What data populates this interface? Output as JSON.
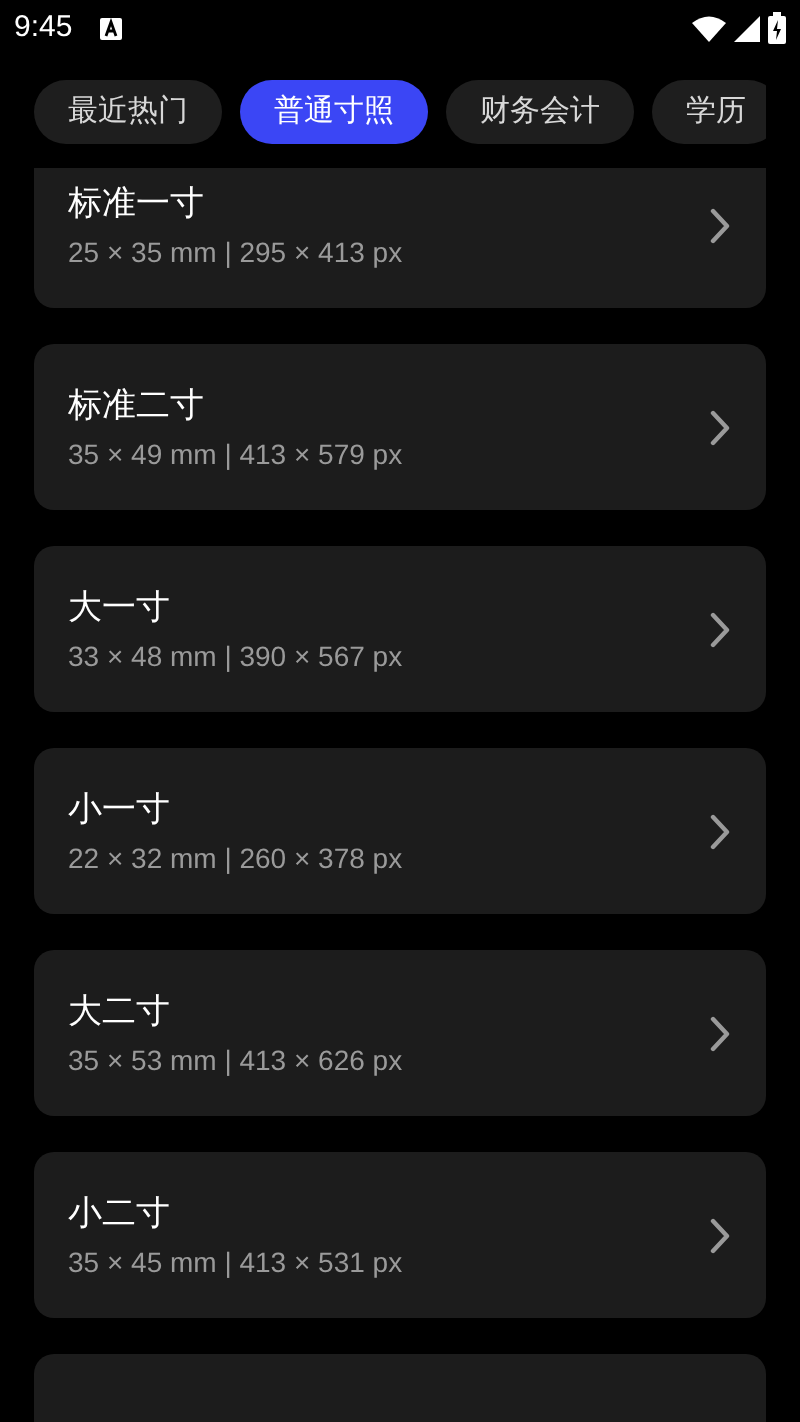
{
  "status_bar": {
    "time": "9:45"
  },
  "tabs": [
    {
      "label": "最近热门",
      "selected": false
    },
    {
      "label": "普通寸照",
      "selected": true
    },
    {
      "label": "财务会计",
      "selected": false
    },
    {
      "label": "学历",
      "selected": false
    }
  ],
  "items": [
    {
      "kind": "size",
      "title": "标准一寸",
      "spec": "25 × 35 mm | 295 × 413 px"
    },
    {
      "kind": "size",
      "title": "标准二寸",
      "spec": "35 × 49 mm | 413 × 579 px"
    },
    {
      "kind": "size",
      "title": "大一寸",
      "spec": "33 × 48 mm | 390 × 567 px"
    },
    {
      "kind": "size",
      "title": "小一寸",
      "spec": "22 × 32 mm | 260 × 378 px"
    },
    {
      "kind": "size",
      "title": "大二寸",
      "spec": "35 × 53 mm | 413 × 626 px"
    },
    {
      "kind": "size",
      "title": "小二寸",
      "spec": "35 × 45 mm | 413 × 531 px"
    },
    {
      "kind": "partial"
    }
  ]
}
